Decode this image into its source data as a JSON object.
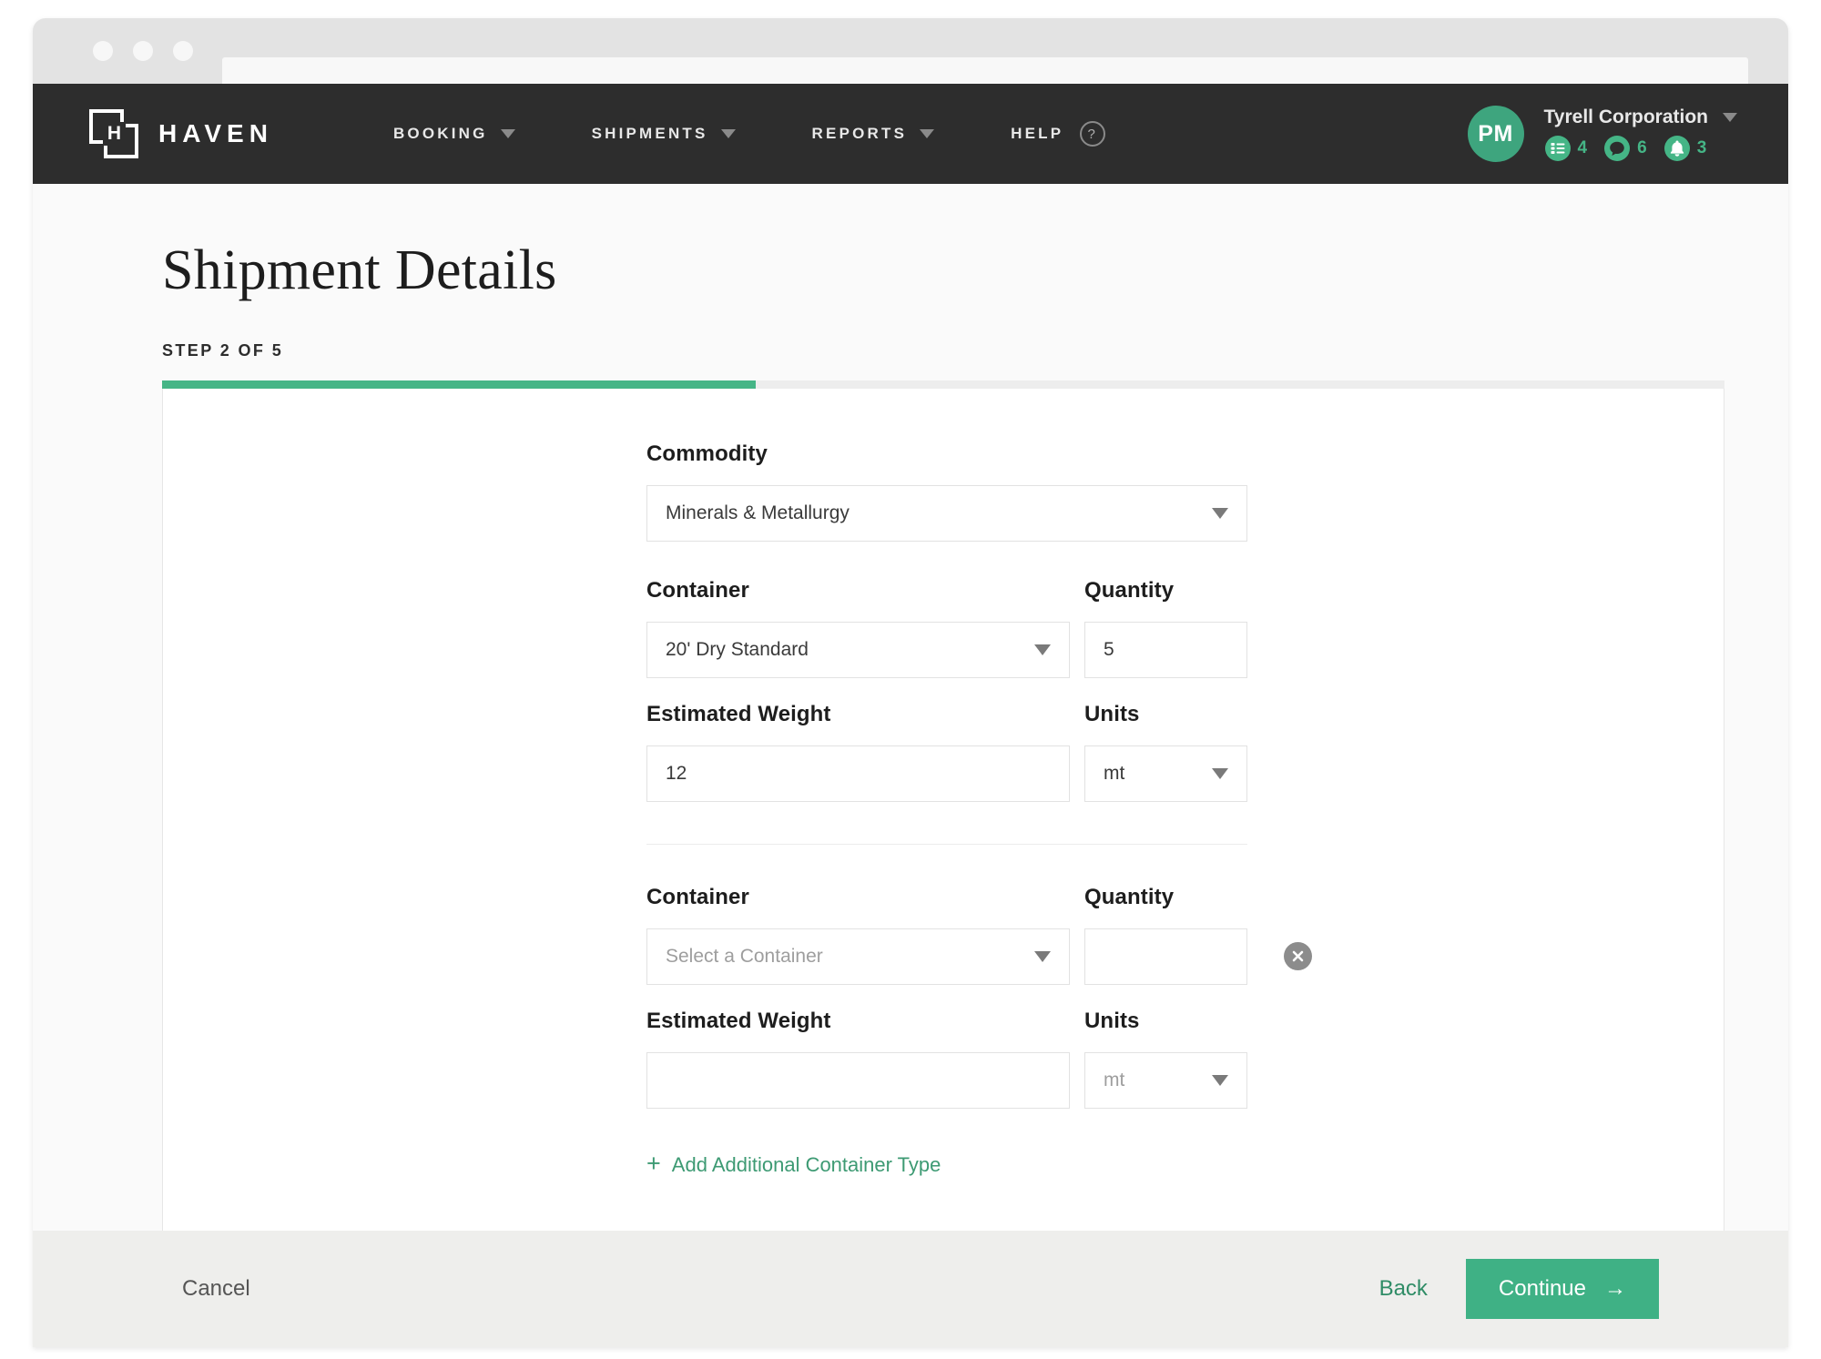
{
  "browser": {
    "url_value": "",
    "url_placeholder": ""
  },
  "nav": {
    "brand_name": "HAVEN",
    "logo_letter": "H",
    "items": [
      {
        "label": "BOOKING",
        "has_caret": true
      },
      {
        "label": "SHIPMENTS",
        "has_caret": true
      },
      {
        "label": "REPORTS",
        "has_caret": true
      },
      {
        "label": "HELP",
        "has_caret": false
      }
    ],
    "help_glyph": "?"
  },
  "account": {
    "avatar_initials": "PM",
    "org_name": "Tyrell Corporation",
    "badges": [
      {
        "icon": "list-icon",
        "count": "4"
      },
      {
        "icon": "chat-icon",
        "count": "6"
      },
      {
        "icon": "bell-icon",
        "count": "3"
      }
    ]
  },
  "header": {
    "title": "Shipment Details",
    "step_label": "STEP 2 OF 5",
    "progress_percent": 38
  },
  "form": {
    "commodity": {
      "label": "Commodity",
      "value": "Minerals & Metallurgy",
      "is_placeholder": false
    },
    "container_groups": [
      {
        "container_label": "Container",
        "container_value": "20' Dry Standard",
        "container_is_placeholder": false,
        "quantity_label": "Quantity",
        "quantity_value": "5",
        "weight_label": "Estimated Weight",
        "weight_value": "12",
        "units_label": "Units",
        "units_value": "mt",
        "units_is_placeholder": false,
        "removable": false
      },
      {
        "container_label": "Container",
        "container_value": "Select a Container",
        "container_is_placeholder": true,
        "quantity_label": "Quantity",
        "quantity_value": "",
        "weight_label": "Estimated Weight",
        "weight_value": "",
        "units_label": "Units",
        "units_value": "mt",
        "units_is_placeholder": true,
        "removable": true
      }
    ],
    "add_link_label": "Add Additional Container Type",
    "add_link_glyph": "+"
  },
  "footer": {
    "cancel_label": "Cancel",
    "back_label": "Back",
    "continue_label": "Continue",
    "continue_arrow": "→"
  },
  "colors": {
    "accent_green": "#45b586",
    "button_green": "#3fb185",
    "link_green": "#3d9a73",
    "nav_dark": "#2d2d2d"
  }
}
